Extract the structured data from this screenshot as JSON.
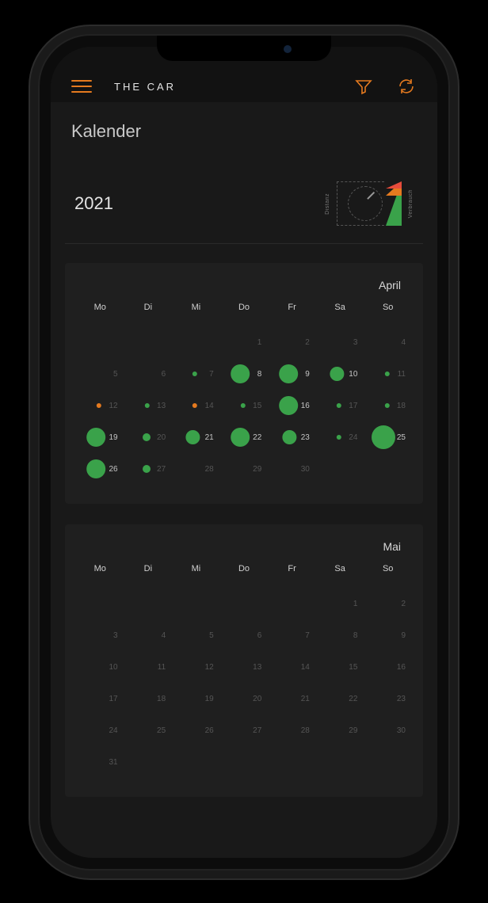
{
  "header": {
    "app_title": "THE CAR"
  },
  "page": {
    "title": "Kalender",
    "year": "2021"
  },
  "legend": {
    "left_label": "Distanz",
    "right_label": "Verbrauch"
  },
  "colors": {
    "accent": "#e57a1f",
    "good": "#3aa24a",
    "bad": "#e74c3c"
  },
  "dow": [
    "Mo",
    "Di",
    "Mi",
    "Do",
    "Fr",
    "Sa",
    "So"
  ],
  "months": [
    {
      "name": "April",
      "lead_blanks": 3,
      "days": [
        {
          "n": 1
        },
        {
          "n": 2
        },
        {
          "n": 3
        },
        {
          "n": 4
        },
        {
          "n": 5
        },
        {
          "n": 6
        },
        {
          "n": 7,
          "dot": {
            "size": 1,
            "color": "green"
          }
        },
        {
          "n": 8,
          "dot": {
            "size": 4,
            "color": "green"
          },
          "bright": true
        },
        {
          "n": 9,
          "dot": {
            "size": 4,
            "color": "green"
          },
          "bright": true
        },
        {
          "n": 10,
          "dot": {
            "size": 3,
            "color": "green"
          },
          "bright": true
        },
        {
          "n": 11,
          "dot": {
            "size": 1,
            "color": "green"
          }
        },
        {
          "n": 12,
          "dot": {
            "size": 1,
            "color": "orange"
          }
        },
        {
          "n": 13,
          "dot": {
            "size": 1,
            "color": "green"
          }
        },
        {
          "n": 14,
          "dot": {
            "size": 1,
            "color": "orange"
          }
        },
        {
          "n": 15,
          "dot": {
            "size": 1,
            "color": "green"
          }
        },
        {
          "n": 16,
          "dot": {
            "size": 4,
            "color": "green"
          },
          "bright": true
        },
        {
          "n": 17,
          "dot": {
            "size": 1,
            "color": "green"
          }
        },
        {
          "n": 18,
          "dot": {
            "size": 1,
            "color": "green"
          }
        },
        {
          "n": 19,
          "dot": {
            "size": 4,
            "color": "green"
          },
          "bright": true
        },
        {
          "n": 20,
          "dot": {
            "size": 2,
            "color": "green"
          }
        },
        {
          "n": 21,
          "dot": {
            "size": 3,
            "color": "green"
          },
          "bright": true
        },
        {
          "n": 22,
          "dot": {
            "size": 4,
            "color": "green"
          },
          "bright": true
        },
        {
          "n": 23,
          "dot": {
            "size": 3,
            "color": "green"
          },
          "bright": true
        },
        {
          "n": 24,
          "dot": {
            "size": 1,
            "color": "green"
          }
        },
        {
          "n": 25,
          "dot": {
            "size": 5,
            "color": "green"
          },
          "bright": true
        },
        {
          "n": 26,
          "dot": {
            "size": 4,
            "color": "green"
          },
          "bright": true
        },
        {
          "n": 27,
          "dot": {
            "size": 2,
            "color": "green"
          }
        },
        {
          "n": 28
        },
        {
          "n": 29
        },
        {
          "n": 30
        }
      ]
    },
    {
      "name": "Mai",
      "lead_blanks": 5,
      "days": [
        {
          "n": 1
        },
        {
          "n": 2
        },
        {
          "n": 3
        },
        {
          "n": 4
        },
        {
          "n": 5
        },
        {
          "n": 6
        },
        {
          "n": 7
        },
        {
          "n": 8
        },
        {
          "n": 9
        },
        {
          "n": 10
        },
        {
          "n": 11
        },
        {
          "n": 12
        },
        {
          "n": 13
        },
        {
          "n": 14
        },
        {
          "n": 15
        },
        {
          "n": 16
        },
        {
          "n": 17
        },
        {
          "n": 18
        },
        {
          "n": 19
        },
        {
          "n": 20
        },
        {
          "n": 21
        },
        {
          "n": 22
        },
        {
          "n": 23
        },
        {
          "n": 24
        },
        {
          "n": 25
        },
        {
          "n": 26
        },
        {
          "n": 27
        },
        {
          "n": 28
        },
        {
          "n": 29
        },
        {
          "n": 30
        },
        {
          "n": 31
        }
      ]
    }
  ]
}
